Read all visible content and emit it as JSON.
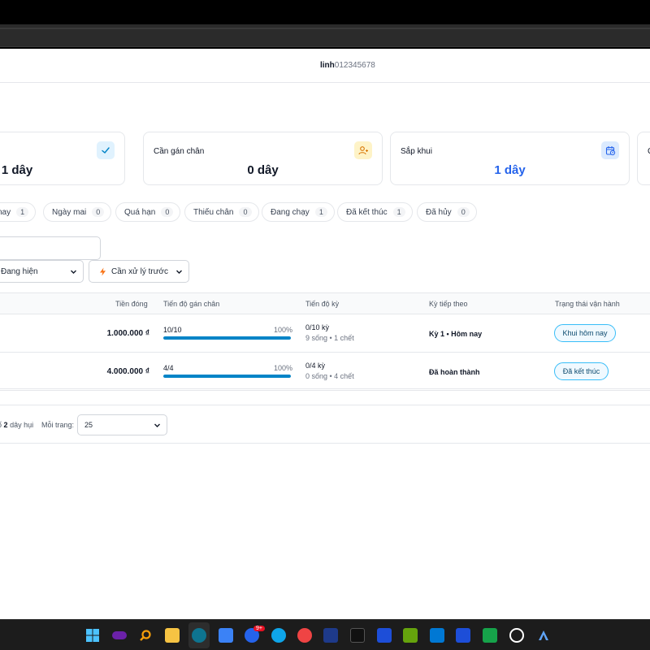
{
  "header": {
    "user_name": "linh",
    "user_phone": "012345678"
  },
  "cards": [
    {
      "label": "",
      "value": "1 dây",
      "icon": "check-icon"
    },
    {
      "label": "Cần gán chân",
      "value": "0 dây",
      "icon": "user-plus-icon"
    },
    {
      "label": "Sắp khui",
      "value": "1 dây",
      "icon": "calendar-clock-icon"
    },
    {
      "label": "C",
      "value": "",
      "icon": ""
    }
  ],
  "filters": [
    {
      "label": "nay",
      "count": "1"
    },
    {
      "label": "Ngày mai",
      "count": "0"
    },
    {
      "label": "Quá hạn",
      "count": "0"
    },
    {
      "label": "Thiếu chân",
      "count": "0"
    },
    {
      "label": "Đang chạy",
      "count": "1"
    },
    {
      "label": "Đã kết thúc",
      "count": "1"
    },
    {
      "label": "Đã hủy",
      "count": "0"
    }
  ],
  "controls": {
    "search_value": "",
    "view_select": "Đang hiện",
    "sort_select": "Cần xử lý trước"
  },
  "table": {
    "headers": [
      "Tiền đóng",
      "Tiến độ gán chân",
      "Tiến độ kỳ",
      "Kỳ tiếp theo",
      "Trạng thái vận hành"
    ],
    "rows": [
      {
        "amount": "1.000.000 ₫",
        "progress_label": "10/10",
        "progress_pct_text": "100%",
        "progress": 1.0,
        "ky_main": "0/10 kỳ",
        "ky_sub": "9 sống • 1 chết",
        "next": "Kỳ 1 • Hôm nay",
        "status": "Khui hôm nay"
      },
      {
        "amount": "4.000.000 ₫",
        "progress_label": "4/4",
        "progress_pct_text": "100%",
        "progress": 1.0,
        "ky_main": "0/4 kỳ",
        "ky_sub": "0 sống • 4 chết",
        "next": "Đã hoàn thành",
        "status": "Đã kết thúc"
      }
    ]
  },
  "footer": {
    "total_prefix": "ố",
    "total_count": "2",
    "total_suffix": "dây hụi",
    "per_page_label": "Mỗi trang:",
    "per_page_value": "25"
  },
  "colors": {
    "accent": "#2563eb",
    "progress": "#0284c7",
    "status_border": "#38bdf8"
  }
}
